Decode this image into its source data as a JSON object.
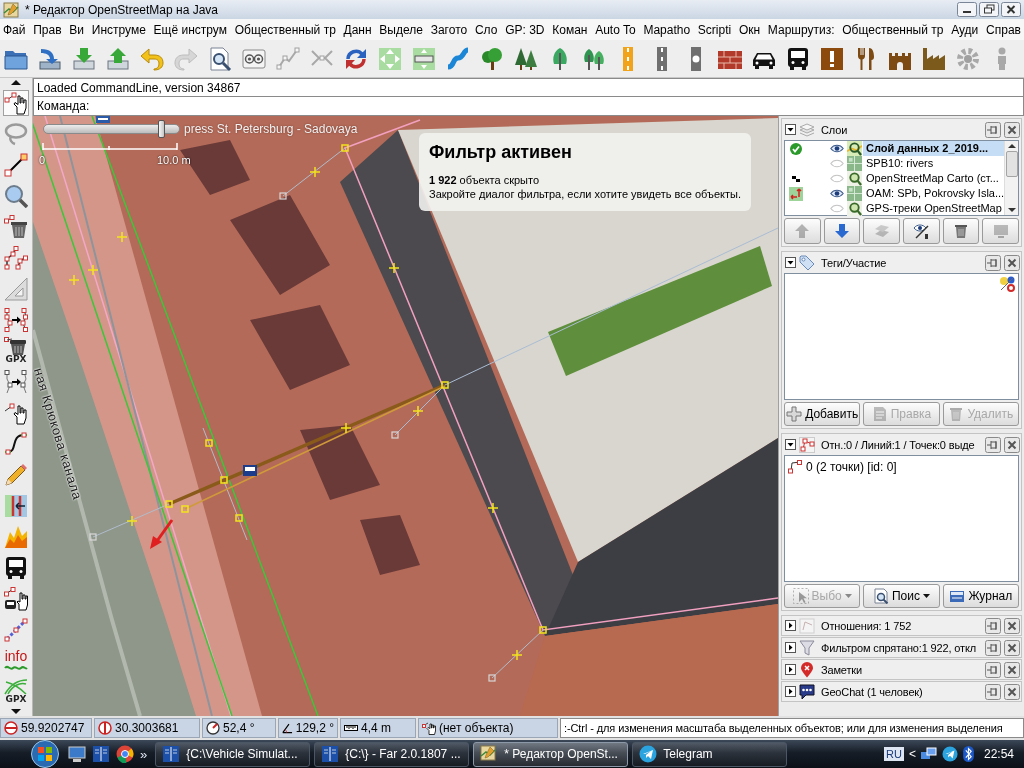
{
  "window": {
    "title": "* Редактор OpenStreetMap на Java"
  },
  "menu": [
    "Фай",
    "Прав",
    "Ви",
    "Инструме",
    "Ещё инструм",
    "Общественный тр",
    "Данн",
    "Выделе",
    "Загото",
    "Сло",
    "GP: 3D",
    "Коман",
    "Auto To",
    "Mapatho",
    "Scripti",
    "Окн",
    "Маршрутиз:",
    "Общественный тр",
    "Ауди",
    "Справ"
  ],
  "toolbar": [
    {
      "kind": "open",
      "disabled": false
    },
    {
      "kind": "open_location",
      "disabled": false
    },
    {
      "kind": "download",
      "disabled": false
    },
    {
      "kind": "upload",
      "disabled": false
    },
    {
      "kind": "undo",
      "disabled": false
    },
    {
      "kind": "redo",
      "disabled": true
    },
    {
      "kind": "preview",
      "disabled": false
    },
    {
      "kind": "wireframe",
      "disabled": false
    },
    {
      "kind": "split",
      "disabled": true
    },
    {
      "kind": "combine",
      "disabled": true
    },
    {
      "kind": "reverse",
      "disabled": false
    },
    {
      "kind": "zoom_fit",
      "disabled": false
    },
    {
      "kind": "zoom_bar",
      "disabled": false
    },
    {
      "kind": "river",
      "disabled": false
    },
    {
      "kind": "tree",
      "disabled": false
    },
    {
      "kind": "conifers",
      "disabled": false
    },
    {
      "kind": "tree2",
      "disabled": false
    },
    {
      "kind": "trees",
      "disabled": false
    },
    {
      "kind": "road_primary",
      "disabled": false
    },
    {
      "kind": "road_track",
      "disabled": false
    },
    {
      "kind": "road_junction",
      "disabled": false
    },
    {
      "kind": "wall",
      "disabled": false
    },
    {
      "kind": "car",
      "disabled": false
    },
    {
      "kind": "bus",
      "disabled": false
    },
    {
      "kind": "shop",
      "disabled": false
    },
    {
      "kind": "food",
      "disabled": false
    },
    {
      "kind": "castle",
      "disabled": false
    },
    {
      "kind": "factory",
      "disabled": false
    },
    {
      "kind": "gear",
      "disabled": true
    },
    {
      "kind": "person",
      "disabled": true
    }
  ],
  "command_line": {
    "log": "Loaded CommandLine, version 34867",
    "prompt": "Команда:"
  },
  "left_toolbar": [
    {
      "kind": "select",
      "selected": true
    },
    {
      "kind": "lasso",
      "selected": false
    },
    {
      "kind": "draw",
      "selected": false
    },
    {
      "kind": "zoom",
      "selected": false
    },
    {
      "kind": "delete",
      "selected": false
    },
    {
      "kind": "split",
      "selected": false
    },
    {
      "kind": "measure",
      "selected": false
    },
    {
      "kind": "improve",
      "selected": false
    },
    {
      "kind": "gpx_delete",
      "label": "GPX",
      "selected": false
    },
    {
      "kind": "simplify",
      "selected": false
    },
    {
      "kind": "hand_node",
      "selected": false
    },
    {
      "kind": "curve",
      "selected": false
    },
    {
      "kind": "pencil",
      "selected": false
    },
    {
      "kind": "align",
      "selected": false
    },
    {
      "kind": "elevation",
      "selected": false
    },
    {
      "kind": "bus",
      "selected": false
    },
    {
      "kind": "bus_hand",
      "selected": false
    },
    {
      "kind": "line_nodes",
      "selected": false
    },
    {
      "kind": "info",
      "label": "info",
      "selected": false
    },
    {
      "kind": "gpx",
      "label": "GPX",
      "selected": false
    }
  ],
  "map": {
    "opacity_slider": {
      "level": 0.87
    },
    "attribution": "press St. Petersburg - Sadovaya",
    "scale": {
      "start": "0",
      "end": "10.0 m"
    },
    "street_label": "ная Крюкова канала",
    "filter_notice": {
      "title": "Фильтр активен",
      "count_line": "**1 922** объекта скрыто",
      "hint": "Закройте диалог фильтра, если хотите увидеть все объекты."
    }
  },
  "layers_panel": {
    "title": "Слои",
    "expanded": true,
    "layers": [
      {
        "name": "Слой данных 2_2019...",
        "kind": "data",
        "selected": true,
        "active": true,
        "visible": true,
        "tiles_pending": false,
        "offset": false
      },
      {
        "name": "SPB10: rivers",
        "kind": "wms",
        "selected": false,
        "active": false,
        "visible": false,
        "tiles_pending": false,
        "offset": false
      },
      {
        "name": "OpenStreetMap Carto (ст...",
        "kind": "tms",
        "selected": false,
        "active": false,
        "visible": false,
        "tiles_pending": true,
        "offset": false
      },
      {
        "name": "OAM: SPb, Pokrovsky Isla...",
        "kind": "wms",
        "selected": false,
        "active": false,
        "visible": true,
        "tiles_pending": false,
        "offset": true
      },
      {
        "name": "GPS-треки OpenStreetMap",
        "kind": "tms",
        "selected": false,
        "active": false,
        "visible": false,
        "tiles_pending": false,
        "offset": false
      }
    ],
    "buttons": [
      {
        "kind": "up",
        "disabled": true
      },
      {
        "kind": "down",
        "disabled": false
      },
      {
        "kind": "merge",
        "disabled": true
      },
      {
        "kind": "visibility",
        "disabled": false
      },
      {
        "kind": "delete",
        "disabled": false
      },
      {
        "kind": "display",
        "disabled": true
      }
    ]
  },
  "tags_panel": {
    "title": "Теги/Участие",
    "expanded": true,
    "buttons": [
      {
        "label": "Добавить",
        "kind": "add",
        "disabled": false
      },
      {
        "label": "Правка",
        "kind": "edit",
        "disabled": true
      },
      {
        "label": "Удалить",
        "kind": "delete",
        "disabled": true
      }
    ]
  },
  "selection_panel": {
    "title": "Отн.:0 / Линий:1 / Точек:0 выде",
    "expanded": true,
    "items": [
      {
        "label": "0 (2 точки) [id: 0]"
      }
    ],
    "buttons": [
      {
        "label": "Выбо",
        "kind": "select",
        "disabled": true,
        "dropdown": true
      },
      {
        "label": "Поис",
        "kind": "search",
        "disabled": false,
        "dropdown": true
      },
      {
        "label": "Журнал",
        "kind": "history",
        "disabled": false,
        "dropdown": false
      }
    ]
  },
  "collapsed_panels": [
    {
      "title": "Отношения: 1 752",
      "kind": "relations",
      "expanded": false
    },
    {
      "title": "Фильтром спрятано:1 922, откл",
      "kind": "filter",
      "expanded": false
    },
    {
      "title": "Заметки",
      "kind": "notes",
      "expanded": false
    },
    {
      "title": "GeoChat (1 человек)",
      "kind": "chat",
      "expanded": false
    }
  ],
  "status_bar": {
    "fields": [
      {
        "kind": "latitude",
        "text": "59.9202747"
      },
      {
        "kind": "longitude",
        "text": "30.3003681"
      },
      {
        "kind": "heading",
        "text": "52,4 °"
      },
      {
        "kind": "angle",
        "text": "129,2 °"
      },
      {
        "kind": "distance",
        "text": "4,4 m"
      },
      {
        "kind": "object",
        "text": "(нет объекта)"
      }
    ],
    "help": ":-Ctrl - для изменения масштаба выделенных объектов; или для изменения выделения"
  },
  "taskbar": {
    "quick_launch_more": "»",
    "tasks": [
      {
        "label": "{C:\\Vehicle Simulat...",
        "kind": "far",
        "selected": false
      },
      {
        "label": "{C:\\} - Far 2.0.1807 ...",
        "kind": "far",
        "selected": false
      },
      {
        "label": "* Редактор OpenSt...",
        "kind": "editor",
        "selected": true
      },
      {
        "label": "Telegram",
        "kind": "telegram",
        "selected": false
      }
    ],
    "language": "RU",
    "tray_toggle": "<",
    "clock": "22:54"
  }
}
